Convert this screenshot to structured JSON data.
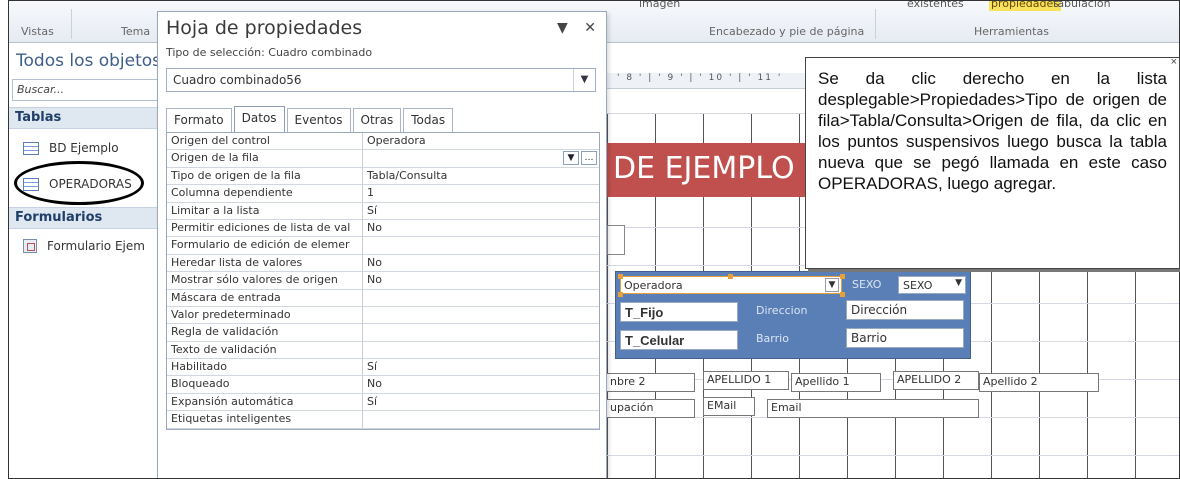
{
  "ribbon": {
    "vistas": "Vistas",
    "tema": "Tema",
    "imagen": "imagen",
    "existentes": "existentes",
    "propiedades": "propiedades",
    "tabulacion": "tabulación",
    "encabezado": "Encabezado y pie de página",
    "herramientas": "Herramientas"
  },
  "nav": {
    "title": "Todos los objetos",
    "search_placeholder": "Buscar...",
    "sections": [
      {
        "label": "Tablas"
      },
      {
        "label": "Formularios"
      }
    ],
    "items": [
      {
        "label": "BD Ejemplo"
      },
      {
        "label": "OPERADORAS"
      },
      {
        "label": "Formulario Ejem"
      }
    ]
  },
  "sheet": {
    "title": "Hoja de propiedades",
    "selection_type": "Tipo de selección: Cuadro combinado",
    "combo_value": "Cuadro combinado56",
    "tabs": [
      {
        "label": "Formato"
      },
      {
        "label": "Datos"
      },
      {
        "label": "Eventos"
      },
      {
        "label": "Otras"
      },
      {
        "label": "Todas"
      }
    ],
    "properties": [
      {
        "key": "Origen del control",
        "value": "Operadora"
      },
      {
        "key": "Origen de la fila",
        "value": ""
      },
      {
        "key": "Tipo de origen de la fila",
        "value": "Tabla/Consulta"
      },
      {
        "key": "Columna dependiente",
        "value": "1"
      },
      {
        "key": "Limitar a la lista",
        "value": "Sí"
      },
      {
        "key": "Permitir ediciones de lista de val",
        "value": "No"
      },
      {
        "key": "Formulario de edición de elemer",
        "value": ""
      },
      {
        "key": "Heredar lista de valores",
        "value": "No"
      },
      {
        "key": "Mostrar sólo valores de origen",
        "value": "No"
      },
      {
        "key": "Máscara de entrada",
        "value": ""
      },
      {
        "key": "Valor predeterminado",
        "value": ""
      },
      {
        "key": "Regla de validación",
        "value": ""
      },
      {
        "key": "Texto de validación",
        "value": ""
      },
      {
        "key": "Habilitado",
        "value": "Sí"
      },
      {
        "key": "Bloqueado",
        "value": "No"
      },
      {
        "key": "Expansión automática",
        "value": "Sí"
      },
      {
        "key": "Etiquetas inteligentes",
        "value": ""
      }
    ]
  },
  "design": {
    "ruler": "' 8 ' | ' 9 ' | ' 10 ' | ' 11 '",
    "banner": "DE EJEMPLO",
    "combo_value": "Operadora",
    "sexo_label": "SEXO",
    "sexo_value": "SEXO",
    "t_fijo": "T_Fijo",
    "direccion_label": "Direccion",
    "direccion_value": "Dirección",
    "t_celular": "T_Celular",
    "barrio_label": "Barrio",
    "barrio_value": "Barrio",
    "nombre2": "nbre 2",
    "apellido1_label": "APELLIDO 1",
    "apellido1_value": "Apellido 1",
    "apellido2_label": "APELLIDO 2",
    "apellido2_value": "Apellido 2",
    "ocupacion": "upación",
    "email_label": "EMail",
    "email_value": "Email"
  },
  "callout": {
    "text": "Se da clic derecho en la lista desplegable>Propiedades>Tipo de origen de fila>Tabla/Consulta>Origen de fila, da clic en los puntos suspensivos luego busca la tabla nueva que se pegó llamada en este caso OPERADORAS, luego agregar."
  }
}
